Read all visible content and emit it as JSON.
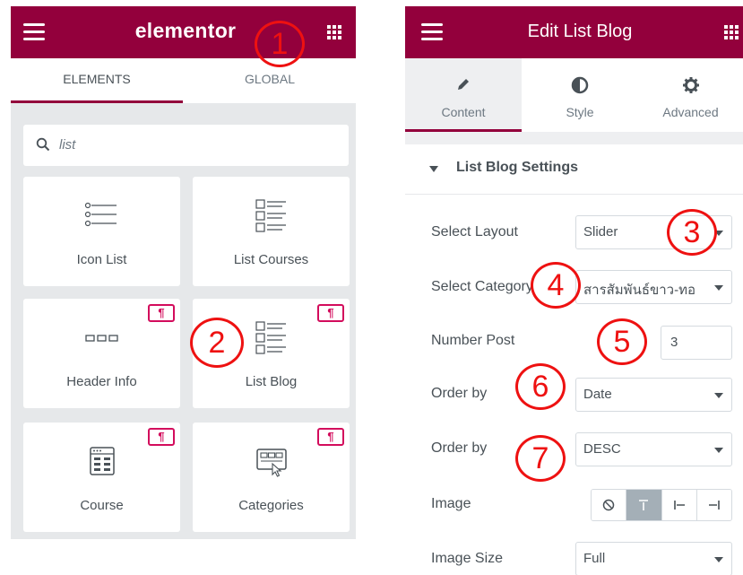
{
  "left_panel": {
    "brand": "elementor",
    "tabs": [
      {
        "label": "ELEMENTS",
        "active": true
      },
      {
        "label": "GLOBAL",
        "active": false
      }
    ],
    "search": {
      "value": "list"
    },
    "widgets": [
      {
        "label": "Icon List",
        "icon": "icon-list-icon",
        "pro": false
      },
      {
        "label": "List Courses",
        "icon": "list-courses-icon",
        "pro": false
      },
      {
        "label": "Header Info",
        "icon": "header-info-icon",
        "pro": true
      },
      {
        "label": "List Blog",
        "icon": "list-blog-icon",
        "pro": true
      },
      {
        "label": "Course",
        "icon": "course-icon",
        "pro": true
      },
      {
        "label": "Categories",
        "icon": "categories-icon",
        "pro": true
      }
    ],
    "pro_badge_glyph": "¶"
  },
  "right_panel": {
    "title": "Edit List Blog",
    "tabs": [
      {
        "label": "Content",
        "icon": "pencil-icon",
        "active": true
      },
      {
        "label": "Style",
        "icon": "half-circle-icon",
        "active": false
      },
      {
        "label": "Advanced",
        "icon": "gear-icon",
        "active": false
      }
    ],
    "section": "List Blog Settings",
    "controls": {
      "layout": {
        "label": "Select Layout",
        "value": "Slider"
      },
      "category": {
        "label": "Select Category",
        "value": "สารสัมพันธ์ขาว-ทอ"
      },
      "number_post": {
        "label": "Number Post",
        "value": "3"
      },
      "order_by": {
        "label": "Order by",
        "value": "Date"
      },
      "order": {
        "label": "Order by",
        "value": "DESC"
      },
      "image": {
        "label": "Image",
        "options": [
          "none-icon",
          "align-top-icon",
          "align-left-icon",
          "align-right-icon"
        ],
        "active_index": 1
      },
      "image_size": {
        "label": "Image Size",
        "value": "Full"
      }
    }
  },
  "callouts": [
    "1",
    "2",
    "3",
    "4",
    "5",
    "6",
    "7"
  ],
  "colors": {
    "brand": "#93003c",
    "callout": "#ee1111",
    "pro": "#d30c5c",
    "panel_bg": "#e6e8ea"
  }
}
